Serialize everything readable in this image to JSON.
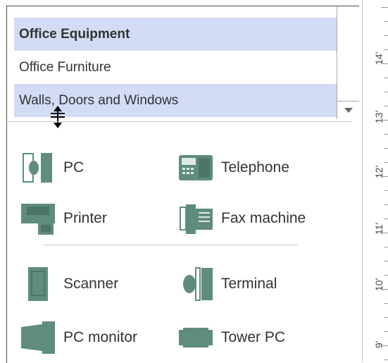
{
  "stencils": {
    "items": [
      {
        "label": "Office Equipment"
      },
      {
        "label": "Office Furniture"
      },
      {
        "label": "Walls, Doors and Windows"
      }
    ]
  },
  "shapes": {
    "group1": [
      {
        "label": "PC",
        "icon": "pc-icon"
      },
      {
        "label": "Telephone",
        "icon": "telephone-icon"
      },
      {
        "label": "Printer",
        "icon": "printer-icon"
      },
      {
        "label": "Fax machine",
        "icon": "fax-machine-icon"
      }
    ],
    "group2": [
      {
        "label": "Scanner",
        "icon": "scanner-icon"
      },
      {
        "label": "Terminal",
        "icon": "terminal-icon"
      },
      {
        "label": "PC monitor",
        "icon": "pc-monitor-icon"
      },
      {
        "label": "Tower PC",
        "icon": "tower-pc-icon"
      }
    ]
  },
  "ruler": {
    "labels": [
      "14'",
      "13'",
      "12'",
      "11'",
      "10'",
      "9'"
    ]
  },
  "colors": {
    "shape_fill": "#5f8c7d",
    "selected_bg": "#d3dcf4"
  }
}
